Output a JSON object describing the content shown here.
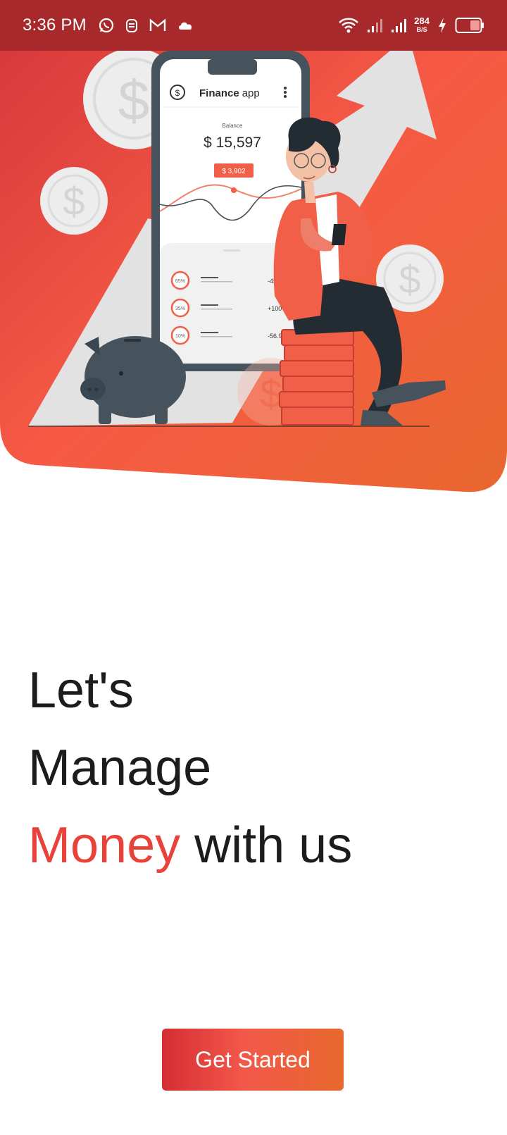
{
  "status_bar": {
    "time": "3:36 PM",
    "net_speed_value": "284",
    "net_speed_unit": "B/S",
    "left_icons": [
      "whatsapp-icon",
      "notification-app-icon",
      "gmail-icon",
      "cloud-icon"
    ],
    "right_icons": [
      "wifi-icon",
      "signal-icon",
      "signal-icon",
      "charging-icon",
      "battery-icon"
    ]
  },
  "hero": {
    "app_name_bold": "Finance",
    "app_name_rest": "app",
    "balance_label": "Balance",
    "balance_value": "$ 15,597",
    "tooltip_value": "$ 3,902",
    "transactions": [
      {
        "pct": "65%",
        "amount": "-45.90"
      },
      {
        "pct": "35%",
        "amount": "+100"
      },
      {
        "pct": "10%",
        "amount": "-56.90"
      }
    ]
  },
  "headline": {
    "line1": "Let's",
    "line2": "Manage",
    "line3_accent": "Money",
    "line3_rest": " with us"
  },
  "cta": {
    "label": "Get Started"
  },
  "colors": {
    "accent": "#e8423a",
    "status_bar": "#a8292b",
    "button_start": "#d52d33",
    "button_end": "#e8682d"
  }
}
